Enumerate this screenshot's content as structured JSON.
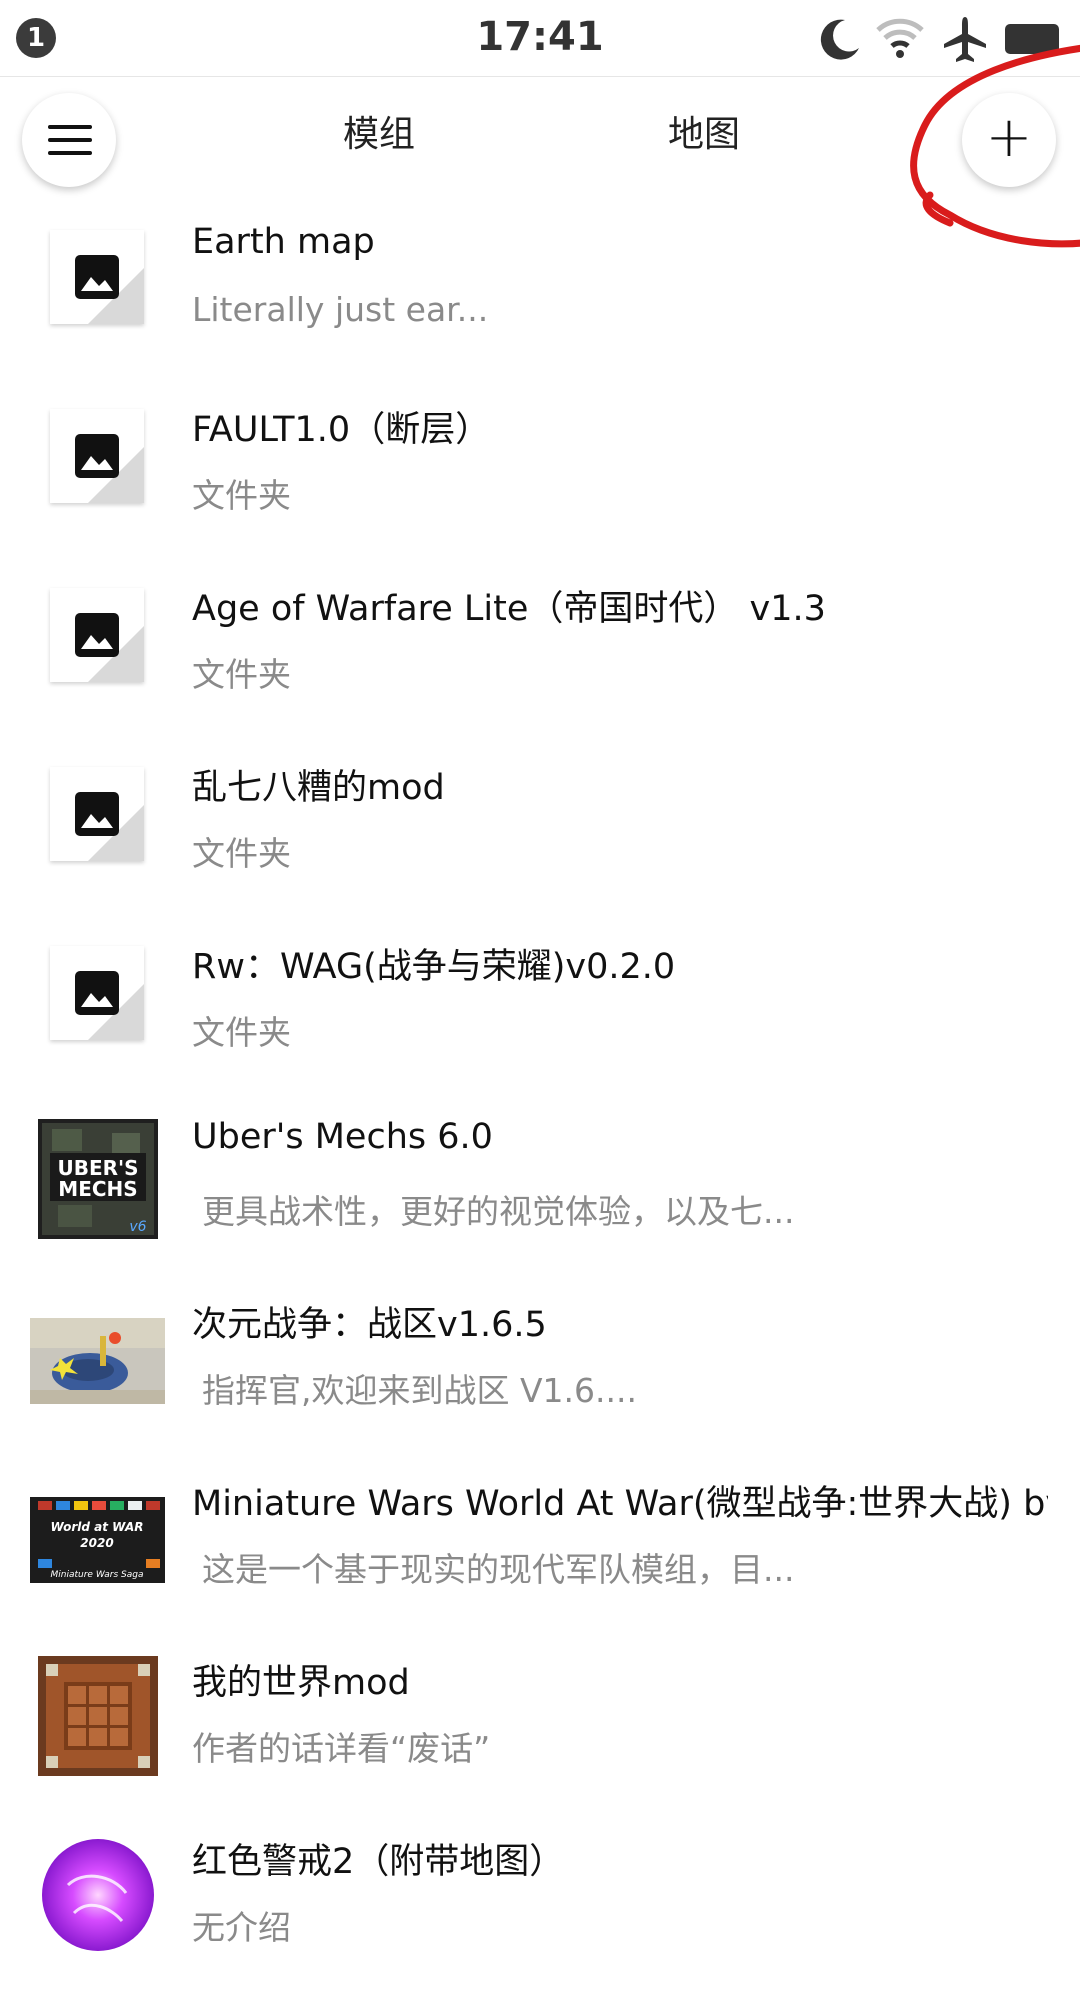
{
  "status_bar": {
    "notification_count": "1",
    "time": "17:41",
    "icons": [
      "moon-icon",
      "wifi-icon",
      "airplane-icon",
      "battery-icon"
    ]
  },
  "top_bar": {
    "tabs": [
      "模组",
      "地图"
    ],
    "add_label": "+"
  },
  "items": [
    {
      "title": "Earth map",
      "subtitle": "Literally just ear...",
      "thumb": "placeholder"
    },
    {
      "title": "FAULT1.0（断层）",
      "subtitle": "文件夹",
      "thumb": "placeholder"
    },
    {
      "title": "Age of Warfare Lite（帝国时代） v1.3",
      "subtitle": "文件夹",
      "thumb": "placeholder"
    },
    {
      "title": "乱七八糟的mod",
      "subtitle": "文件夹",
      "thumb": "placeholder"
    },
    {
      "title": "Rw：WAG(战争与荣耀)v0.2.0",
      "subtitle": "文件夹",
      "thumb": "placeholder"
    },
    {
      "title": "Uber's Mechs 6.0",
      "subtitle": "更具战术性，更好的视觉体验，以及七...",
      "thumb": "ubers-mechs",
      "thumb_text": [
        "UBER'S",
        "MECHS",
        "v6"
      ]
    },
    {
      "title": "次元战争：战区v1.6.5",
      "subtitle": "指挥官,欢迎来到战区 V1.6....",
      "thumb": "dimension-war"
    },
    {
      "title": "Miniature Wars World At War(微型战争:世界大战) by",
      "subtitle": "这是一个基于现实的现代军队模组，目...",
      "thumb": "miniature-wars",
      "thumb_text": [
        "World at WAR",
        "2020",
        "Miniature Wars Saga"
      ]
    },
    {
      "title": "我的世界mod",
      "subtitle": "作者的话详看“废话”",
      "thumb": "minecraft"
    },
    {
      "title": "红色警戒2（附带地图）",
      "subtitle": "无介绍",
      "thumb": "purple-orb"
    }
  ],
  "colors": {
    "annotation_red": "#d91c1c",
    "subtitle_gray": "#8a8a8a"
  }
}
